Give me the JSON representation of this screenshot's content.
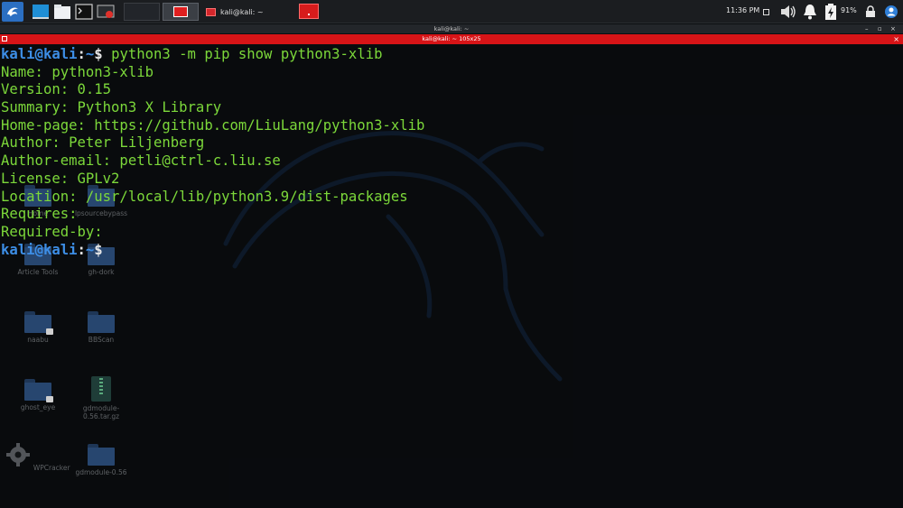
{
  "taskbar": {
    "clock": "11:36 PM",
    "battery_percent": "91%",
    "task_label": "kali@kali: ~",
    "icons": [
      "kali-dragon-icon",
      "show-desktop-icon",
      "file-manager-icon",
      "terminal-icon",
      "screen-recorder-icon",
      "volume-icon",
      "notification-bell-icon",
      "power-icon",
      "lock-icon",
      "user-icon"
    ]
  },
  "desktop": {
    "icons": [
      {
        "label": "Home"
      },
      {
        "label": "lpsourcebypass"
      },
      {
        "label": "Article Tools"
      },
      {
        "label": "gh-dork"
      },
      {
        "label": "naabu"
      },
      {
        "label": "BBScan"
      },
      {
        "label": "ghost_eye"
      },
      {
        "label": "gdmodule-0.56.tar.gz"
      },
      {
        "label": "WPCracker"
      },
      {
        "label": "gdmodule-0.56"
      }
    ]
  },
  "terminal": {
    "window_title": "kali@kali: ~",
    "tab_title": "kali@kali: ~ 105x25",
    "prompt": {
      "user": "kali@kali",
      "sep": ":",
      "path": "~",
      "symbol": "$"
    },
    "command": "python3 -m pip show python3-xlib",
    "output": [
      "Name: python3-xlib",
      "Version: 0.15",
      "Summary: Python3 X Library",
      "Home-page: https://github.com/LiuLang/python3-xlib",
      "Author: Peter Liljenberg",
      "Author-email: petli@ctrl-c.liu.se",
      "License: GPLv2",
      "Location: /usr/local/lib/python3.9/dist-packages",
      "Requires:",
      "Required-by:"
    ]
  },
  "colors": {
    "prompt_blue": "#3d8ee6",
    "output_green": "#7cd83a",
    "tab_red": "#d71417",
    "taskbar_bg": "#1b1d20"
  }
}
